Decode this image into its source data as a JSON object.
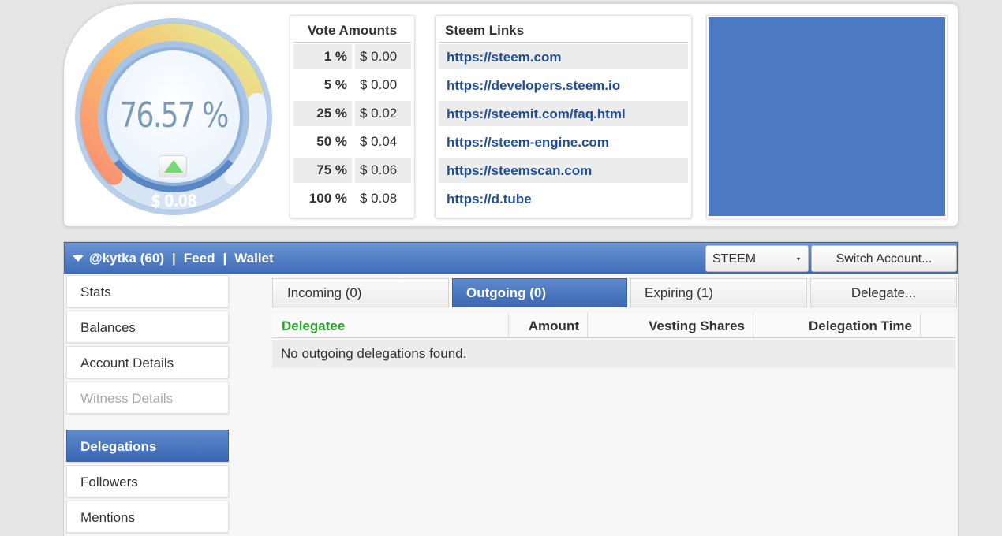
{
  "gauge": {
    "percent": 76.57,
    "percent_text": "76.57 %",
    "value_text": "$ 0.08",
    "arrow": "up-arrow-icon",
    "colors": {
      "arc_start": "#f98f74",
      "arc_mid": "#fbbd6b",
      "arc_end": "#e3ef9a",
      "ring": "#8fb2db",
      "base": "#5b86c6"
    }
  },
  "vote_amounts": {
    "title": "Vote Amounts",
    "rows": [
      {
        "pct": "1 %",
        "amount": "$ 0.00"
      },
      {
        "pct": "5 %",
        "amount": "$ 0.00"
      },
      {
        "pct": "25 %",
        "amount": "$ 0.02"
      },
      {
        "pct": "50 %",
        "amount": "$ 0.04"
      },
      {
        "pct": "75 %",
        "amount": "$ 0.06"
      },
      {
        "pct": "100 %",
        "amount": "$ 0.08"
      }
    ]
  },
  "steem_links": {
    "title": "Steem Links",
    "links": [
      "https://steem.com",
      "https://developers.steem.io",
      "https://steemit.com/faq.html",
      "https://steem-engine.com",
      "https://steemscan.com",
      "https://d.tube"
    ]
  },
  "account_bar": {
    "account": "@kytka (60)",
    "separator": "|",
    "feed": "Feed",
    "wallet": "Wallet",
    "currency": "STEEM",
    "currency_caret": "▾",
    "switch_account": "Switch Account..."
  },
  "sidebar": {
    "items": [
      {
        "label": "Stats"
      },
      {
        "label": "Balances"
      },
      {
        "label": "Account Details"
      },
      {
        "label": "Witness Details"
      },
      {
        "label": "Delegations"
      },
      {
        "label": "Followers"
      },
      {
        "label": "Mentions"
      }
    ]
  },
  "delegation_tabs": {
    "incoming": "Incoming (0)",
    "outgoing": "Outgoing (0)",
    "expiring": "Expiring (1)",
    "delegate": "Delegate..."
  },
  "delegation_table": {
    "headers": [
      "Delegatee",
      "Amount",
      "Vesting Shares",
      "Delegation Time"
    ],
    "empty_message": "No outgoing delegations found."
  },
  "colors": {
    "accent_blue": "#4d79c2",
    "link_blue": "#1f4f9b",
    "delegatee_green": "#2aa12a"
  }
}
